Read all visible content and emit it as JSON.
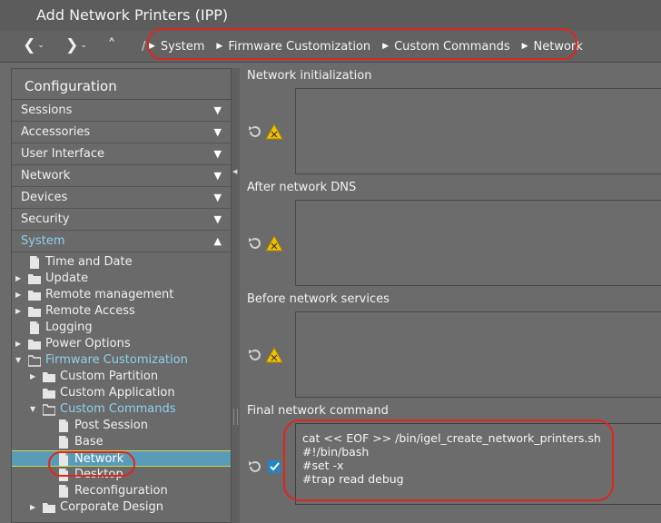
{
  "window": {
    "title": "Add Network Printers (IPP)"
  },
  "nav": {
    "back_icon": "chevron-left-icon",
    "forward_icon": "chevron-right-icon",
    "up_icon": "chevron-up-icon",
    "separator": "/",
    "breadcrumbs": [
      "System",
      "Firmware Customization",
      "Custom Commands",
      "Network"
    ]
  },
  "sidebar": {
    "header": "Configuration",
    "categories": [
      {
        "label": "Sessions",
        "expanded": false
      },
      {
        "label": "Accessories",
        "expanded": false
      },
      {
        "label": "User Interface",
        "expanded": false
      },
      {
        "label": "Network",
        "expanded": false
      },
      {
        "label": "Devices",
        "expanded": false
      },
      {
        "label": "Security",
        "expanded": false
      },
      {
        "label": "System",
        "expanded": true
      }
    ],
    "tree": [
      {
        "label": "Time and Date",
        "level": 1,
        "icon": "page",
        "expander": ""
      },
      {
        "label": "Update",
        "level": 1,
        "icon": "folder",
        "expander": "▶"
      },
      {
        "label": "Remote management",
        "level": 1,
        "icon": "folder",
        "expander": "▶"
      },
      {
        "label": "Remote Access",
        "level": 1,
        "icon": "folder",
        "expander": "▶"
      },
      {
        "label": "Logging",
        "level": 1,
        "icon": "page",
        "expander": ""
      },
      {
        "label": "Power Options",
        "level": 1,
        "icon": "folder",
        "expander": "▶"
      },
      {
        "label": "Firmware Customization",
        "level": 1,
        "icon": "folder-open",
        "expander": "▼",
        "blue": true
      },
      {
        "label": "Custom Partition",
        "level": 2,
        "icon": "folder",
        "expander": "▶"
      },
      {
        "label": "Custom Application",
        "level": 2,
        "icon": "folder",
        "expander": ""
      },
      {
        "label": "Custom Commands",
        "level": 2,
        "icon": "folder-open",
        "expander": "▼",
        "blue": true
      },
      {
        "label": "Post Session",
        "level": 3,
        "icon": "page",
        "expander": ""
      },
      {
        "label": "Base",
        "level": 3,
        "icon": "page",
        "expander": ""
      },
      {
        "label": "Network",
        "level": 3,
        "icon": "page",
        "expander": "",
        "selected": true
      },
      {
        "label": "Desktop",
        "level": 3,
        "icon": "page",
        "expander": ""
      },
      {
        "label": "Reconfiguration",
        "level": 3,
        "icon": "page",
        "expander": ""
      },
      {
        "label": "Corporate Design",
        "level": 2,
        "icon": "folder",
        "expander": "▶"
      }
    ]
  },
  "content": {
    "sections": [
      {
        "label": "Network initialization",
        "value": "",
        "status": "warning"
      },
      {
        "label": "After network DNS",
        "value": "",
        "status": "warning"
      },
      {
        "label": "Before network services",
        "value": "",
        "status": "warning"
      },
      {
        "label": "Final network command",
        "value_lines": [
          "cat << EOF >> /bin/igel_create_network_printers.sh",
          "#!/bin/bash",
          "#set -x",
          "#trap read debug"
        ],
        "status": "ok"
      }
    ]
  },
  "colors": {
    "accent_blue": "#8ed0ee",
    "selection": "#5a9cb8",
    "annotation_red": "#e0251c",
    "warning_yellow": "#f2c200"
  }
}
